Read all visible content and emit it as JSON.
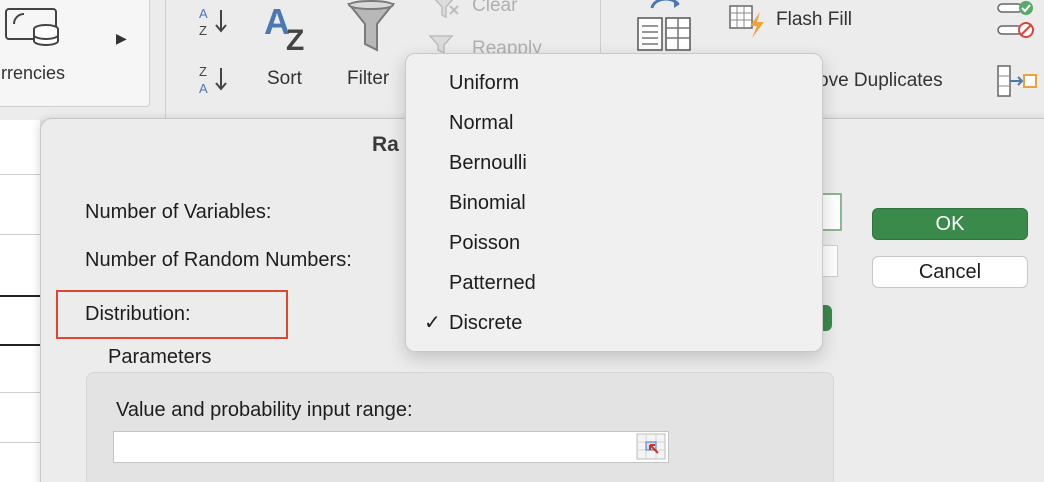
{
  "ribbon": {
    "currencies_label": "urrencies",
    "sort_label": "Sort",
    "filter_label": "Filter",
    "clear_label": "Clear",
    "reapply_label": "Reapply",
    "flash_fill_label": "Flash Fill",
    "remove_duplicates_label": "ove Duplicates"
  },
  "dialog": {
    "title": "Ra",
    "number_of_variables_label": "Number of Variables:",
    "number_of_random_numbers_label": "Number of Random Numbers:",
    "distribution_label": "Distribution:",
    "parameters_label": "Parameters",
    "value_range_label": "Value and probability input range:",
    "value_range_value": "",
    "ok_label": "OK",
    "cancel_label": "Cancel"
  },
  "distribution_menu": {
    "items": [
      {
        "label": "Uniform",
        "checked": false
      },
      {
        "label": "Normal",
        "checked": false
      },
      {
        "label": "Bernoulli",
        "checked": false
      },
      {
        "label": "Binomial",
        "checked": false
      },
      {
        "label": "Poisson",
        "checked": false
      },
      {
        "label": "Patterned",
        "checked": false
      },
      {
        "label": "Discrete",
        "checked": true
      }
    ],
    "check_glyph": "✓"
  },
  "colors": {
    "ok_button": "#3a8a4c",
    "highlight_box": "#e0452f",
    "ribbon_icon_blue": "#4a78b5",
    "ribbon_icon_orange": "#f0a23a"
  },
  "icons": [
    "currencies-icon",
    "expand-arrow-icon",
    "sort-ascending-icon",
    "sort-descending-icon",
    "sort-az-icon",
    "filter-funnel-icon",
    "clear-filter-icon",
    "reapply-filter-icon",
    "text-to-columns-icon",
    "flash-fill-icon",
    "remove-duplicates-icon",
    "data-validation-icon",
    "consolidate-icon",
    "range-select-icon"
  ]
}
